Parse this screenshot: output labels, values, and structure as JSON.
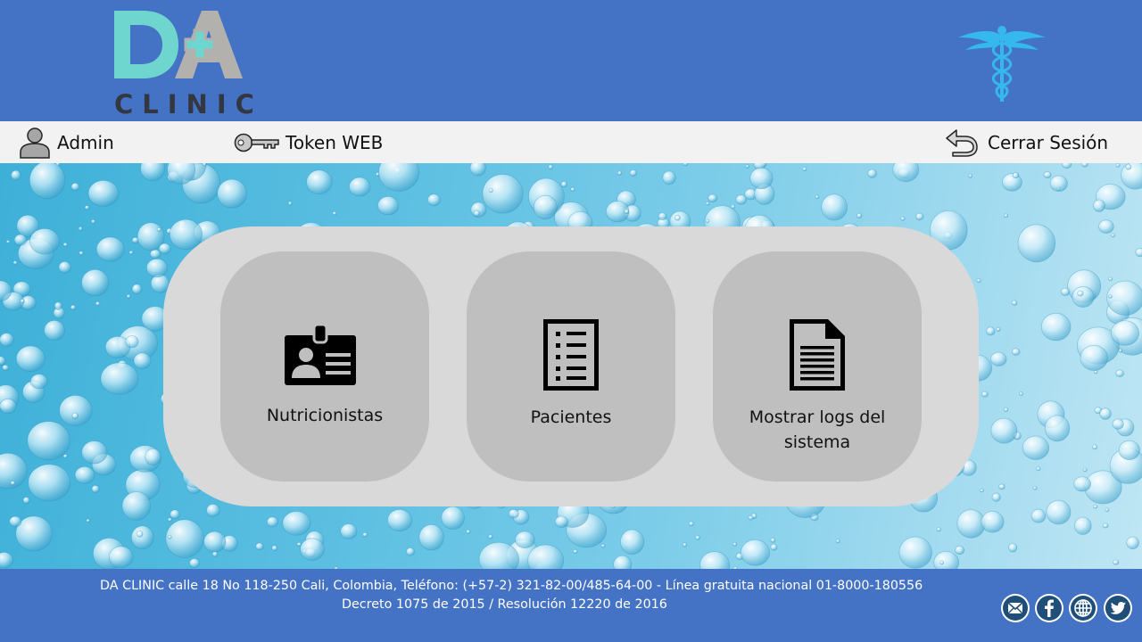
{
  "brand": {
    "logo_initials": "DA",
    "logo_name": "CLINIC",
    "accent_color": "#4472c4"
  },
  "nav": {
    "admin_label": "Admin",
    "admin_icon": "user-icon",
    "token_label": "Token WEB",
    "token_icon": "key-icon",
    "logout_label": "Cerrar Sesión",
    "logout_icon": "return-arrow-icon"
  },
  "menu": {
    "tiles": [
      {
        "label": "Nutricionistas",
        "icon": "id-card-icon"
      },
      {
        "label": "Pacientes",
        "icon": "checklist-icon"
      },
      {
        "label": "Mostrar logs del sistema",
        "icon": "document-icon"
      }
    ]
  },
  "footer": {
    "line1": "DA CLINIC calle 18 No 118-250 Cali, Colombia, Teléfono: (+57-2) 321-82-00/485-64-00 - Línea gratuita nacional 01-8000-180556",
    "line2": "Decreto 1075 de 2015 / Resolución 12220 de 2016",
    "social": [
      "mail-icon",
      "facebook-icon",
      "globe-icon",
      "twitter-icon"
    ]
  }
}
